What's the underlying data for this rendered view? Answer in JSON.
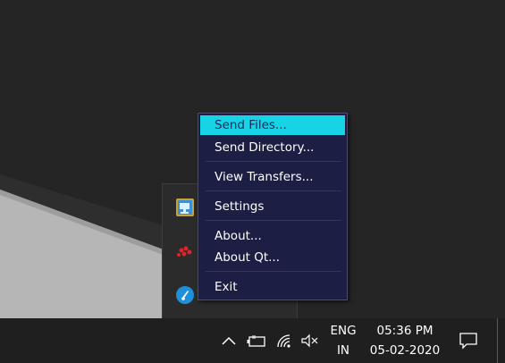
{
  "context_menu": {
    "items": [
      {
        "label": "Send Files...",
        "highlighted": true
      },
      {
        "label": "Send Directory..."
      },
      {
        "label": "View Transfers..."
      },
      {
        "label": "Settings"
      },
      {
        "label": "About..."
      },
      {
        "label": "About Qt..."
      },
      {
        "label": "Exit"
      }
    ]
  },
  "tray_flyout": {
    "icons": [
      "monitor-app-icon",
      "red-dots-app-icon",
      "blue-circle-app-icon"
    ]
  },
  "taskbar": {
    "tray_icons": [
      "chevron-up-icon",
      "battery-icon",
      "wifi-icon",
      "speaker-muted-icon"
    ],
    "language": {
      "line1": "ENG",
      "line2": "IN"
    },
    "clock": {
      "time": "05:36 PM",
      "date": "05-02-2020"
    },
    "notification_icon": "action-center-icon"
  },
  "colors": {
    "menu_bg": "#1c1e44",
    "menu_highlight": "#16d3e6",
    "taskbar_bg": "#1f1f1f"
  }
}
